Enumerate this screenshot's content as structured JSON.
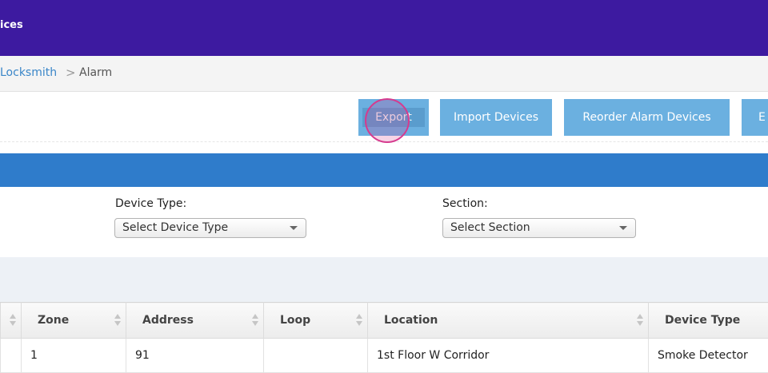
{
  "header": {
    "title": "ices"
  },
  "breadcrumb": {
    "link": "Locksmith",
    "separator": ">",
    "current": "Alarm"
  },
  "toolbar": {
    "export_label": "Export",
    "import_label": "Import Devices",
    "reorder_label": "Reorder Alarm Devices",
    "partial_label": "E"
  },
  "filters": {
    "device_type_label": "Device Type:",
    "device_type_value": "Select Device Type",
    "section_label": "Section:",
    "section_value": "Select Section"
  },
  "table": {
    "columns": [
      "",
      "Zone",
      "Address",
      "Loop",
      "Location",
      "Device Type"
    ],
    "rows": [
      [
        "",
        "1",
        "91",
        "",
        "1st Floor W Corridor",
        "Smoke Detector"
      ]
    ]
  },
  "colors": {
    "topbar": "#3d1aa0",
    "accent_blue": "#2f7ccb",
    "button": "#6bb0e0",
    "link": "#3a86c8"
  }
}
